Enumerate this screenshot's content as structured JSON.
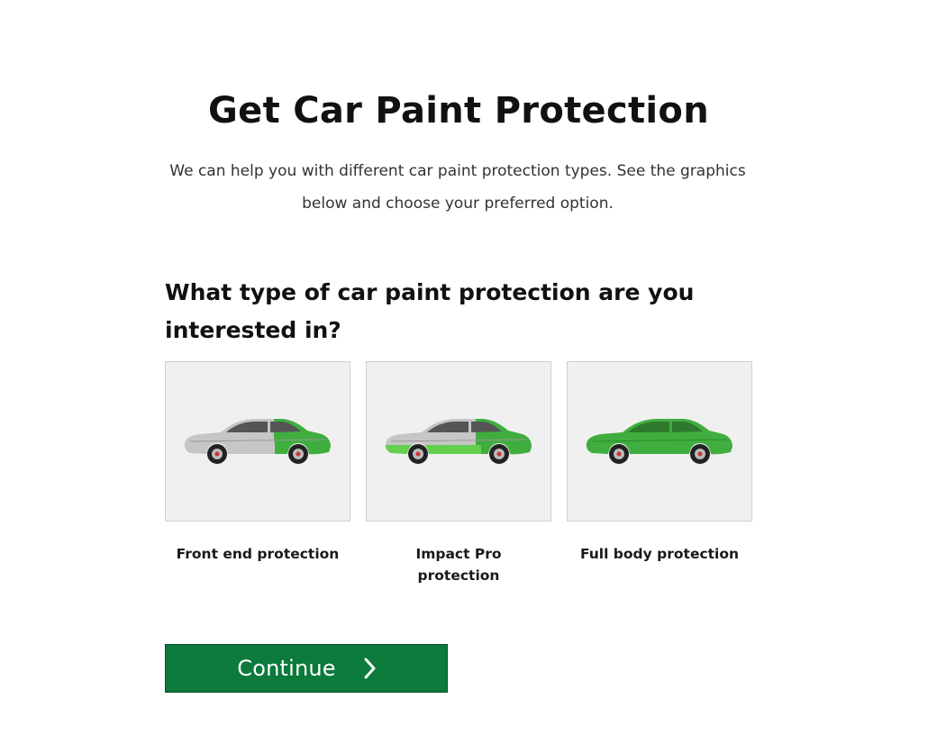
{
  "header": {
    "title": "Get Car Paint Protection",
    "subtitle": "We can help you with different car paint protection types. See the graphics below and choose your preferred option."
  },
  "question": "What type of car paint protection are you interested in?",
  "options": [
    {
      "label": "Front end protection",
      "icon": "car-front-end-icon"
    },
    {
      "label": "Impact Pro protection",
      "icon": "car-impact-pro-icon"
    },
    {
      "label": "Full body protection",
      "icon": "car-full-body-icon"
    }
  ],
  "continue_button": {
    "label": "Continue",
    "icon": "chevron-right-icon"
  },
  "colors": {
    "accent_green": "#0b7a3a",
    "protection_green": "#3fae3f",
    "car_silver": "#c8c8c8",
    "tile_background": "#f0f0f0"
  }
}
